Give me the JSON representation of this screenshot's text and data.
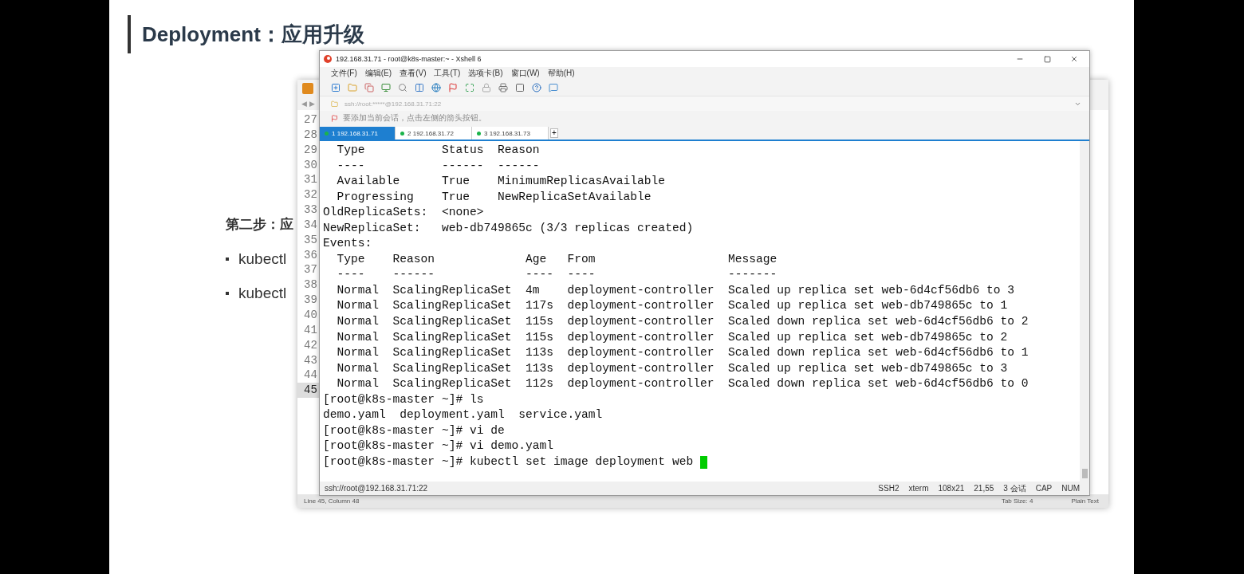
{
  "slide": {
    "title": "Deployment：应用升级",
    "step": "第二步：应",
    "bullets": [
      "kubectl",
      "kubectl"
    ]
  },
  "editor": {
    "line_numbers": [
      {
        "number": "27",
        "current": false
      },
      {
        "number": "28",
        "current": false
      },
      {
        "number": "29",
        "current": false
      },
      {
        "number": "30",
        "current": false
      },
      {
        "number": "31",
        "current": false
      },
      {
        "number": "32",
        "current": false
      },
      {
        "number": "33",
        "current": false
      },
      {
        "number": "34",
        "current": false
      },
      {
        "number": "35",
        "current": false
      },
      {
        "number": "36",
        "current": false
      },
      {
        "number": "37",
        "current": false
      },
      {
        "number": "38",
        "current": false
      },
      {
        "number": "39",
        "current": false
      },
      {
        "number": "40",
        "current": false
      },
      {
        "number": "41",
        "current": false
      },
      {
        "number": "42",
        "current": false
      },
      {
        "number": "43",
        "current": false
      },
      {
        "number": "44",
        "current": false
      },
      {
        "number": "45",
        "current": true
      }
    ],
    "nav_arrows": "◀ ▶",
    "status_position": "Line 45, Column 48",
    "tab_size": "Tab Size: 4",
    "syntax": "Plain Text"
  },
  "xshell": {
    "title": "192.168.31.71 - root@k8s-master:~ - Xshell 6",
    "menu": [
      "文件(F)",
      "编辑(E)",
      "查看(V)",
      "工具(T)",
      "选项卡(B)",
      "窗口(W)",
      "帮助(H)"
    ],
    "address": "ssh://root:*****@192.168.31.71:22",
    "hint": "要添加当前会话，点击左侧的箭头按钮。",
    "tabs": [
      {
        "number": "1",
        "label": "192.168.31.71",
        "selected": true,
        "connected": true
      },
      {
        "number": "2",
        "label": "192.168.31.72",
        "selected": false,
        "connected": true
      },
      {
        "number": "3",
        "label": "192.168.31.73",
        "selected": false,
        "connected": true
      }
    ],
    "new_tab": "+",
    "terminal": {
      "lines": [
        "  Type           Status  Reason",
        "  ----           ------  ------",
        "  Available      True    MinimumReplicasAvailable",
        "  Progressing    True    NewReplicaSetAvailable",
        "OldReplicaSets:  <none>",
        "NewReplicaSet:   web-db749865c (3/3 replicas created)",
        "Events:",
        "  Type    Reason             Age   From                   Message",
        "  ----    ------             ----  ----                   -------",
        "  Normal  ScalingReplicaSet  4m    deployment-controller  Scaled up replica set web-6d4cf56db6 to 3",
        "  Normal  ScalingReplicaSet  117s  deployment-controller  Scaled up replica set web-db749865c to 1",
        "  Normal  ScalingReplicaSet  115s  deployment-controller  Scaled down replica set web-6d4cf56db6 to 2",
        "  Normal  ScalingReplicaSet  115s  deployment-controller  Scaled up replica set web-db749865c to 2",
        "  Normal  ScalingReplicaSet  113s  deployment-controller  Scaled down replica set web-6d4cf56db6 to 1",
        "  Normal  ScalingReplicaSet  113s  deployment-controller  Scaled up replica set web-db749865c to 3",
        "  Normal  ScalingReplicaSet  112s  deployment-controller  Scaled down replica set web-6d4cf56db6 to 0",
        "[root@k8s-master ~]# ls",
        "demo.yaml  deployment.yaml  service.yaml",
        "[root@k8s-master ~]# vi de",
        "[root@k8s-master ~]# vi demo.yaml",
        "[root@k8s-master ~]# kubectl set image deployment web "
      ],
      "cursor_visible": true
    },
    "status_bar": {
      "address": "ssh://root@192.168.31.71:22",
      "items": [
        "SSH2",
        "xterm",
        "108x21",
        "21,55",
        "3 会话",
        "CAP",
        "NUM"
      ]
    }
  }
}
